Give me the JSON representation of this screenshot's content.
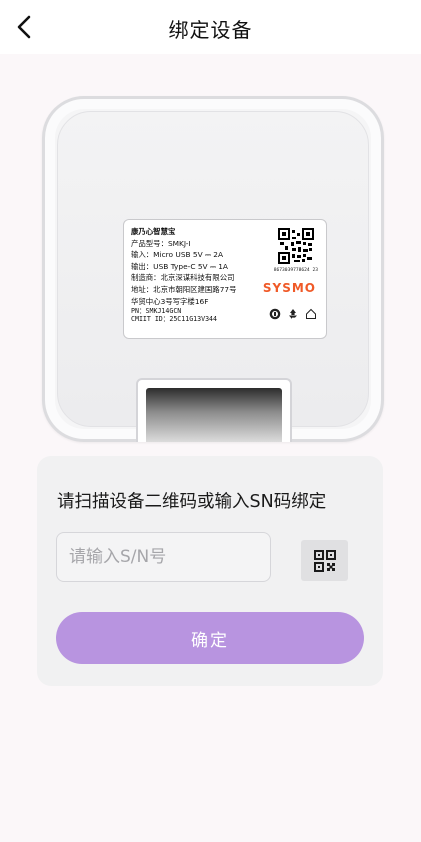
{
  "header": {
    "title": "绑定设备"
  },
  "device_label": {
    "product_name": "康乃心智慧宝",
    "model": "产品型号：SMKJ-I",
    "input": "输入：Micro USB 5V ⎓ 2A",
    "output": "输出：USB Type-C 5V ⎓ 1A",
    "manufacturer": "制造商：北京深谋科技有限公司",
    "address_line1": "地址：北京市朝阳区建国路77号",
    "address_line2": "华贸中心3号写字楼16F",
    "pn": "PN：SMKJ14GCN",
    "cmiit": "CMIIT ID：25C11G13V344",
    "serial": "8673039778624 23",
    "brand": "SYSMO"
  },
  "form": {
    "instruction": "请扫描设备二维码或输入SN码绑定",
    "sn_placeholder": "请输入S/N号",
    "sn_value": "",
    "confirm_label": "确定"
  },
  "colors": {
    "accent": "#b894e0",
    "page_bg": "#fbf7f9",
    "card_bg": "#f1f1f2",
    "brand_orange": "#f05a28"
  },
  "icons": {
    "back": "chevron-left-icon",
    "scan": "qr-scan-icon"
  }
}
